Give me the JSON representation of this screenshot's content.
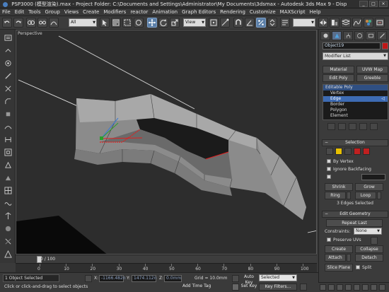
{
  "window": {
    "title": "PSP3000 (模型渲染).max   - Project Folder: C:\\Documents and Settings\\Administrator\\My Documents\\3dsmax     - Autodesk 3ds Max 9      - Disp"
  },
  "menubar": {
    "items": [
      "File",
      "Edit",
      "Tools",
      "Group",
      "Views",
      "Create",
      "Modifiers",
      "reactor",
      "Animation",
      "Graph Editors",
      "Rendering",
      "Customize",
      "MAXScript",
      "Help"
    ]
  },
  "toolbar": {
    "selection_filter": "All",
    "ref_coord": "View"
  },
  "viewport": {
    "label": "Perspective"
  },
  "command_panel": {
    "object_name": "Object19",
    "object_color": "#c01818",
    "modifier_list": "Modifier List",
    "buttons": {
      "material": "Material",
      "uvw_map": "UVW Map",
      "edit_poly": "Edit Poly",
      "greeble": "Greeble"
    },
    "stack": {
      "root": "Editable Poly",
      "items": [
        "Vertex",
        "Edge",
        "Border",
        "Polygon",
        "Element"
      ],
      "selected": "Edge"
    },
    "selection": {
      "title": "Selection",
      "by_vertex": "By Vertex",
      "ignore_backfacing": "Ignore Backfacing",
      "shrink": "Shrink",
      "grow": "Grow",
      "ring": "Ring",
      "loop": "Loop",
      "status": "3 Edges Selected"
    },
    "edit_geometry": {
      "title": "Edit Geometry",
      "repeat_last": "Repeat Last",
      "constraints_label": "Constraints:",
      "constraints_value": "None",
      "preserve_uvs": "Preserve UVs",
      "create": "Create",
      "collapse": "Collapse",
      "attach": "Attach",
      "detach": "Detach",
      "slice_plane": "Slice Plane",
      "split": "Split"
    }
  },
  "timeline": {
    "frame_label": "0 / 100",
    "ticks": [
      "0",
      "10",
      "20",
      "30",
      "40",
      "50",
      "60",
      "70",
      "80",
      "90",
      "100"
    ]
  },
  "status": {
    "selection_count": "1 Object Selected",
    "prompt": "Click or click-and-drag to select objects",
    "x_label": "X:",
    "x_value": "-1166.482n",
    "y_label": "Y:",
    "y_value": "1474.112n",
    "z_label": "Z:",
    "z_value": "0.0mm",
    "grid": "Grid = 10.0mm",
    "add_time_tag": "Add Time Tag",
    "auto_key": "Auto Key",
    "key_mode": "Selected",
    "set_key": "Set Key",
    "key_filters": "Key Filters..."
  }
}
